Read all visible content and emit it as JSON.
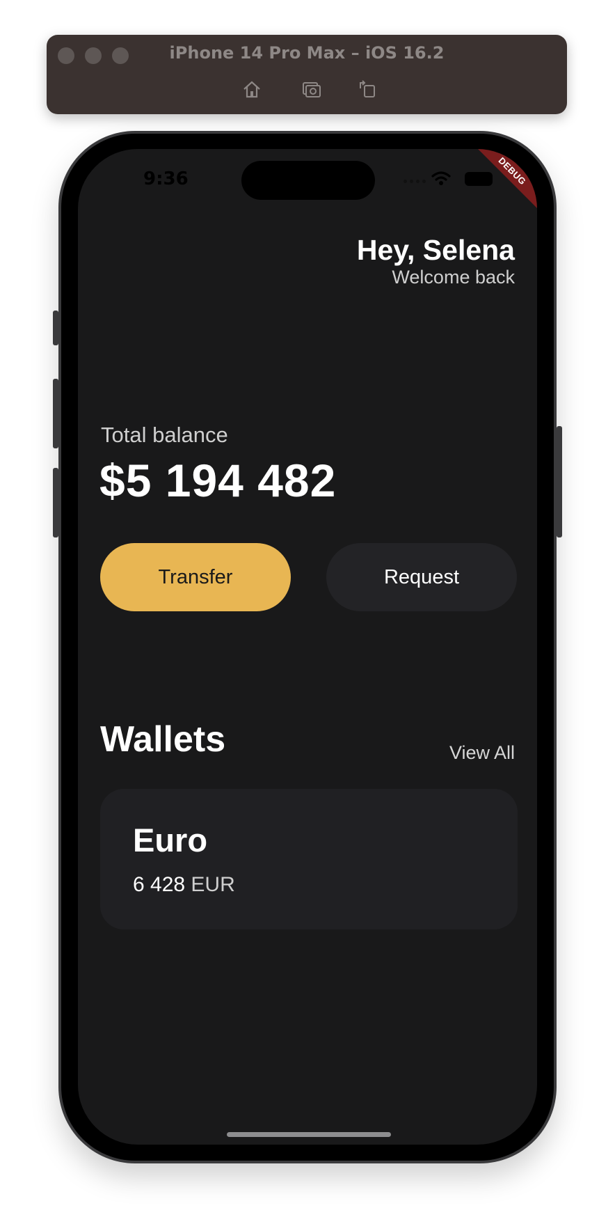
{
  "simulator": {
    "title": "iPhone 14 Pro Max – iOS 16.2",
    "tools": [
      "home-icon",
      "screenshot-icon",
      "rotate-icon"
    ]
  },
  "status_bar": {
    "time": "9:36"
  },
  "debug_banner": "DEBUG",
  "header": {
    "title": "Hey, Selena",
    "subtitle": "Welcome back"
  },
  "balance": {
    "label": "Total balance",
    "amount": "$5 194 482"
  },
  "actions": {
    "transfer_label": "Transfer",
    "request_label": "Request"
  },
  "wallets": {
    "title": "Wallets",
    "view_all_label": "View All",
    "items": [
      {
        "name": "Euro",
        "amount": "6 428",
        "currency": "EUR"
      }
    ]
  },
  "colors": {
    "accent": "#e8b653",
    "background": "#19191a",
    "card": "#202023"
  }
}
